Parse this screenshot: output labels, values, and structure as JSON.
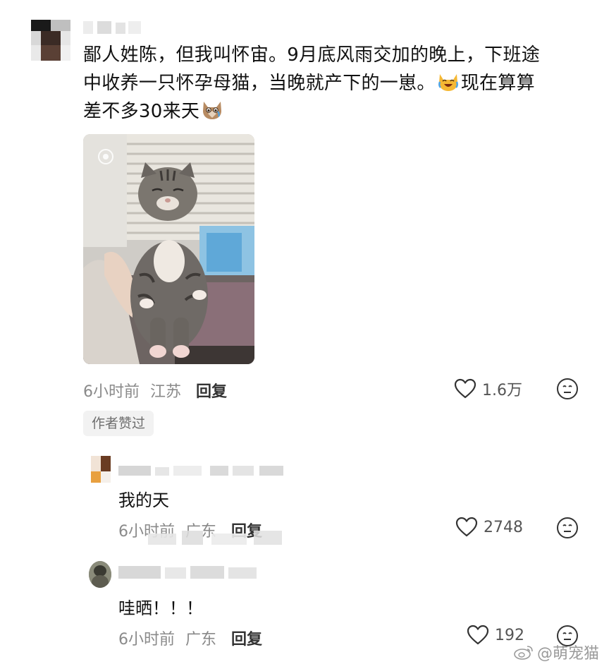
{
  "main_comment": {
    "text_line1": "鄙人姓陈，但我叫怀宙。9月底风雨交加的晚上，下班途",
    "text_line2": "中收养一只怀孕母猫，当晚就产下的一崽。",
    "text_line2_tail": "现在算算",
    "text_line3": "差不多30来天",
    "emoji_1": "crying-laughing-cat-emoji",
    "emoji_2": "teary-cat-emoji",
    "time": "6小时前",
    "location": "江苏",
    "reply_label": "回复",
    "like_count": "1.6万",
    "author_liked_badge": "作者赞过"
  },
  "replies": [
    {
      "text": "我的天",
      "time": "6小时前",
      "location": "广东",
      "reply_label": "回复",
      "like_count": "2748"
    },
    {
      "text": "哇晒！！！",
      "time": "6小时前",
      "location": "广东",
      "reply_label": "回复",
      "like_count": "192"
    }
  ],
  "watermark": "@萌宠猫",
  "icons": {
    "like": "heart-outline-icon",
    "emoji_react": "neutral-face-icon",
    "weibo": "weibo-logo-icon"
  },
  "colors": {
    "text": "#111111",
    "meta": "#8a8a8a",
    "badge_bg": "#f2f2f2"
  }
}
